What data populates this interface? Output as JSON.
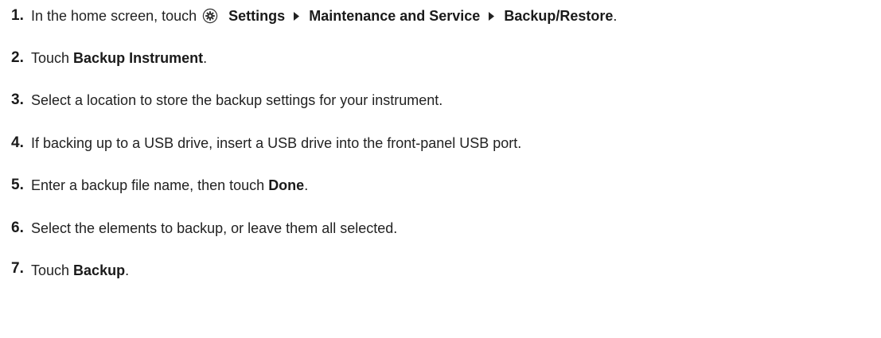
{
  "steps": [
    {
      "number": "1.",
      "intro": "In the home screen, touch",
      "path": [
        "Settings",
        "Maintenance and Service",
        "Backup/Restore"
      ],
      "end": "."
    },
    {
      "number": "2.",
      "before": "Touch ",
      "bold": "Backup Instrument",
      "after": "."
    },
    {
      "number": "3.",
      "text": "Select a location to store the backup settings for your instrument."
    },
    {
      "number": "4.",
      "text": "If backing up to a USB drive, insert a USB drive into the front-panel USB port."
    },
    {
      "number": "5.",
      "before": "Enter a backup file name, then touch ",
      "bold": "Done",
      "after": "."
    },
    {
      "number": "6.",
      "text": "Select the elements to backup, or leave them all selected."
    },
    {
      "number": "7.",
      "before": "Touch ",
      "bold": "Backup",
      "after": "."
    }
  ],
  "icons": {
    "settings": "gear-icon",
    "separator": "triangle-right-icon"
  }
}
